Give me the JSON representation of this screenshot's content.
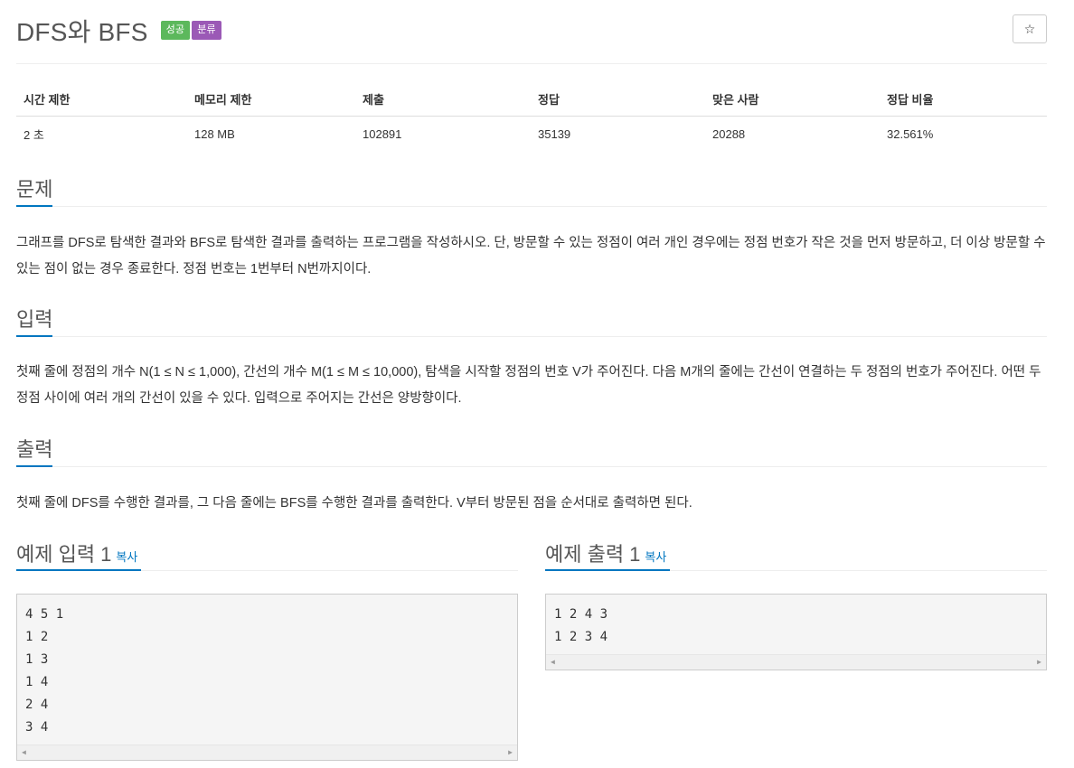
{
  "problem": {
    "title": "DFS와 BFS",
    "badges": {
      "success": "성공",
      "tag": "분류"
    },
    "star_icon": "☆"
  },
  "info_table": {
    "headers": [
      "시간 제한",
      "메모리 제한",
      "제출",
      "정답",
      "맞은 사람",
      "정답 비율"
    ],
    "values": [
      "2 초",
      "128 MB",
      "102891",
      "35139",
      "20288",
      "32.561%"
    ]
  },
  "sections": {
    "problem": {
      "title": "문제",
      "text": "그래프를 DFS로 탐색한 결과와 BFS로 탐색한 결과를 출력하는 프로그램을 작성하시오. 단, 방문할 수 있는 정점이 여러 개인 경우에는 정점 번호가 작은 것을 먼저 방문하고, 더 이상 방문할 수 있는 점이 없는 경우 종료한다. 정점 번호는 1번부터 N번까지이다."
    },
    "input": {
      "title": "입력",
      "text": "첫째 줄에 정점의 개수 N(1 ≤ N ≤ 1,000), 간선의 개수 M(1 ≤ M ≤ 10,000), 탐색을 시작할 정점의 번호 V가 주어진다. 다음 M개의 줄에는 간선이 연결하는 두 정점의 번호가 주어진다. 어떤 두 정점 사이에 여러 개의 간선이 있을 수 있다. 입력으로 주어지는 간선은 양방향이다."
    },
    "output": {
      "title": "출력",
      "text": "첫째 줄에 DFS를 수행한 결과를, 그 다음 줄에는 BFS를 수행한 결과를 출력한다. V부터 방문된 점을 순서대로 출력하면 된다."
    }
  },
  "samples": {
    "copy_label": "복사",
    "input": {
      "title": "예제 입력 1",
      "content": "4 5 1\n1 2\n1 3\n1 4\n2 4\n3 4"
    },
    "output": {
      "title": "예제 출력 1",
      "content": "1 2 4 3\n1 2 3 4"
    }
  },
  "colors": {
    "success_badge": "#5cb85c",
    "tag_badge": "#9b59b6",
    "accent": "#0076c0"
  }
}
